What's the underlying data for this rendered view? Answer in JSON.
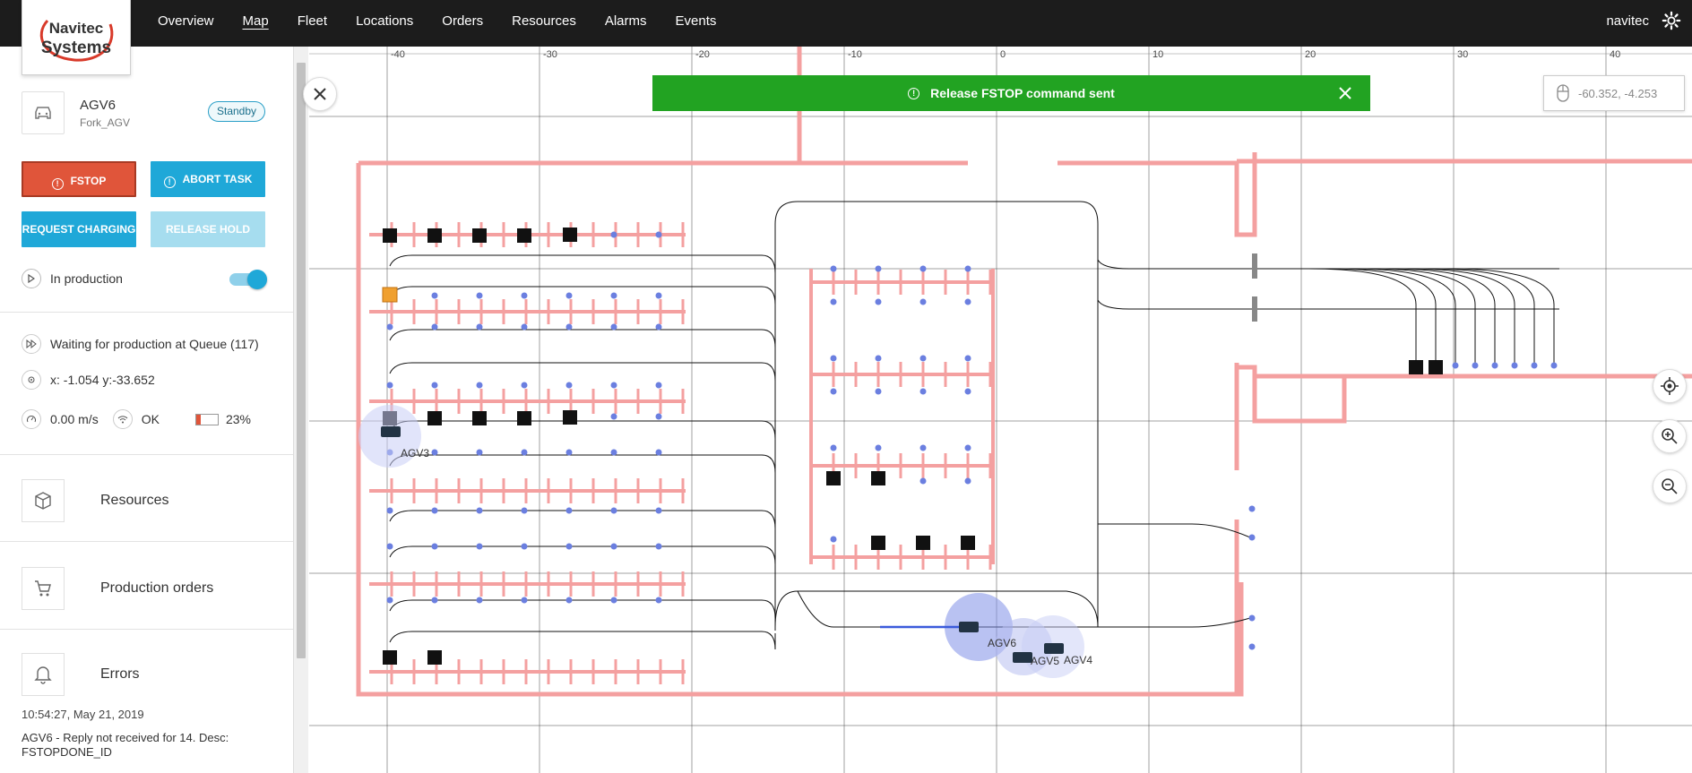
{
  "app": {
    "logo_line1": "Navitec",
    "logo_line2": "Systems",
    "user": "navitec"
  },
  "nav": {
    "items": [
      {
        "label": "Overview",
        "active": false
      },
      {
        "label": "Map",
        "active": true
      },
      {
        "label": "Fleet",
        "active": false
      },
      {
        "label": "Locations",
        "active": false
      },
      {
        "label": "Orders",
        "active": false
      },
      {
        "label": "Resources",
        "active": false
      },
      {
        "label": "Alarms",
        "active": false
      },
      {
        "label": "Events",
        "active": false
      }
    ]
  },
  "vehicle": {
    "name": "AGV6",
    "type": "Fork_AGV",
    "state": "Standby",
    "icon": "car-icon"
  },
  "actions": {
    "fstop": "FSTOP",
    "abort": "ABORT TASK",
    "charge": "REQUEST CHARGING",
    "release": "RELEASE HOLD"
  },
  "production": {
    "label": "In production",
    "enabled": true
  },
  "status": {
    "waiting": "Waiting for production at Queue (117)",
    "x_label": "x:",
    "x": "-1.054",
    "y_label": "y:",
    "y": "-33.652",
    "speed": "0.00 m/s",
    "wifi": "OK",
    "battery": "23%",
    "battery_fraction": 0.23
  },
  "sections": {
    "resources": "Resources",
    "orders": "Production orders",
    "errors": "Errors"
  },
  "error": {
    "time": "10:54:27, May 21, 2019",
    "text": "AGV6 - Reply not received for 14. Desc: FSTOPDONE_ID"
  },
  "toast": {
    "message": "Release FSTOP command sent",
    "color": "#22a322"
  },
  "cursor_coords": "-60.352, -4.253",
  "map": {
    "ruler_ticks": [
      "-40",
      "-30",
      "-20",
      "-10",
      "0",
      "10",
      "20",
      "30",
      "40"
    ],
    "agv_labels": [
      "AGV3",
      "AGV6",
      "AGV5",
      "AGV4"
    ],
    "wall_color": "#f4a0a0",
    "node_color": "#6b7fe0"
  },
  "colors": {
    "fstop": "#e0553a",
    "primary": "#1fa8d8",
    "primary_disabled": "#a6ddef",
    "topbar": "#1c1c1c"
  }
}
